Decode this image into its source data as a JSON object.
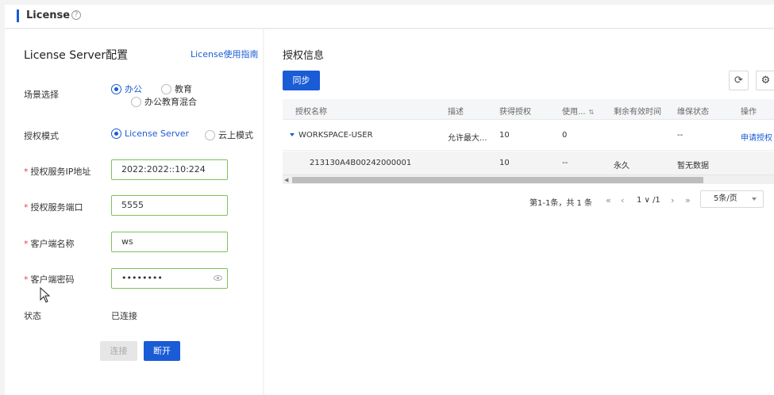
{
  "header": {
    "title": "License",
    "help_icon": "question-circle-icon",
    "help_glyph": "?"
  },
  "left": {
    "title": "License Server配置",
    "guide_link": "License使用指南",
    "scene": {
      "label": "场景选择",
      "options": [
        {
          "label": "办公",
          "selected": true
        },
        {
          "label": "教育",
          "selected": false
        },
        {
          "label": "办公教育混合",
          "selected": false
        }
      ]
    },
    "mode": {
      "label": "授权模式",
      "options": [
        {
          "label": "License Server",
          "selected": true
        },
        {
          "label": "云上模式",
          "selected": false
        }
      ]
    },
    "fields": {
      "ip": {
        "label": "授权服务IP地址",
        "value": "2022:2022::10:224"
      },
      "port": {
        "label": "授权服务端口",
        "value": "5555"
      },
      "client": {
        "label": "客户端名称",
        "value": "ws"
      },
      "password": {
        "label": "客户端密码",
        "value": "••••••••"
      }
    },
    "required_mark": "*",
    "status": {
      "label": "状态",
      "value": "已连接"
    },
    "connect_label": "连接",
    "disconnect_label": "断开"
  },
  "right": {
    "title": "授权信息",
    "sync_label": "同步",
    "refresh_glyph": "⟳",
    "settings_glyph": "⚙",
    "columns": [
      "授权名称",
      "描述",
      "获得授权",
      "使用...",
      "剩余有效时间",
      "维保状态",
      "操作"
    ],
    "sort_glyph": "⇅",
    "row_parent": {
      "name": "WORKSPACE-USER",
      "desc": "允许最大...",
      "granted": "10",
      "used": "0",
      "remaining": "",
      "maintenance": "--",
      "action": "申请授权"
    },
    "row_child": {
      "name": "213130A4B00242000001",
      "desc": "",
      "granted": "10",
      "used": "--",
      "remaining": "永久",
      "maintenance": "暂无数据"
    },
    "pager": {
      "count": "第1-1条，共 1 条",
      "page": "1",
      "page_total": "/1",
      "page_size": "5条/页"
    }
  },
  "colors": {
    "accent": "#1a5cd6",
    "required": "#e5484d",
    "valid_border": "#7cc35a"
  }
}
